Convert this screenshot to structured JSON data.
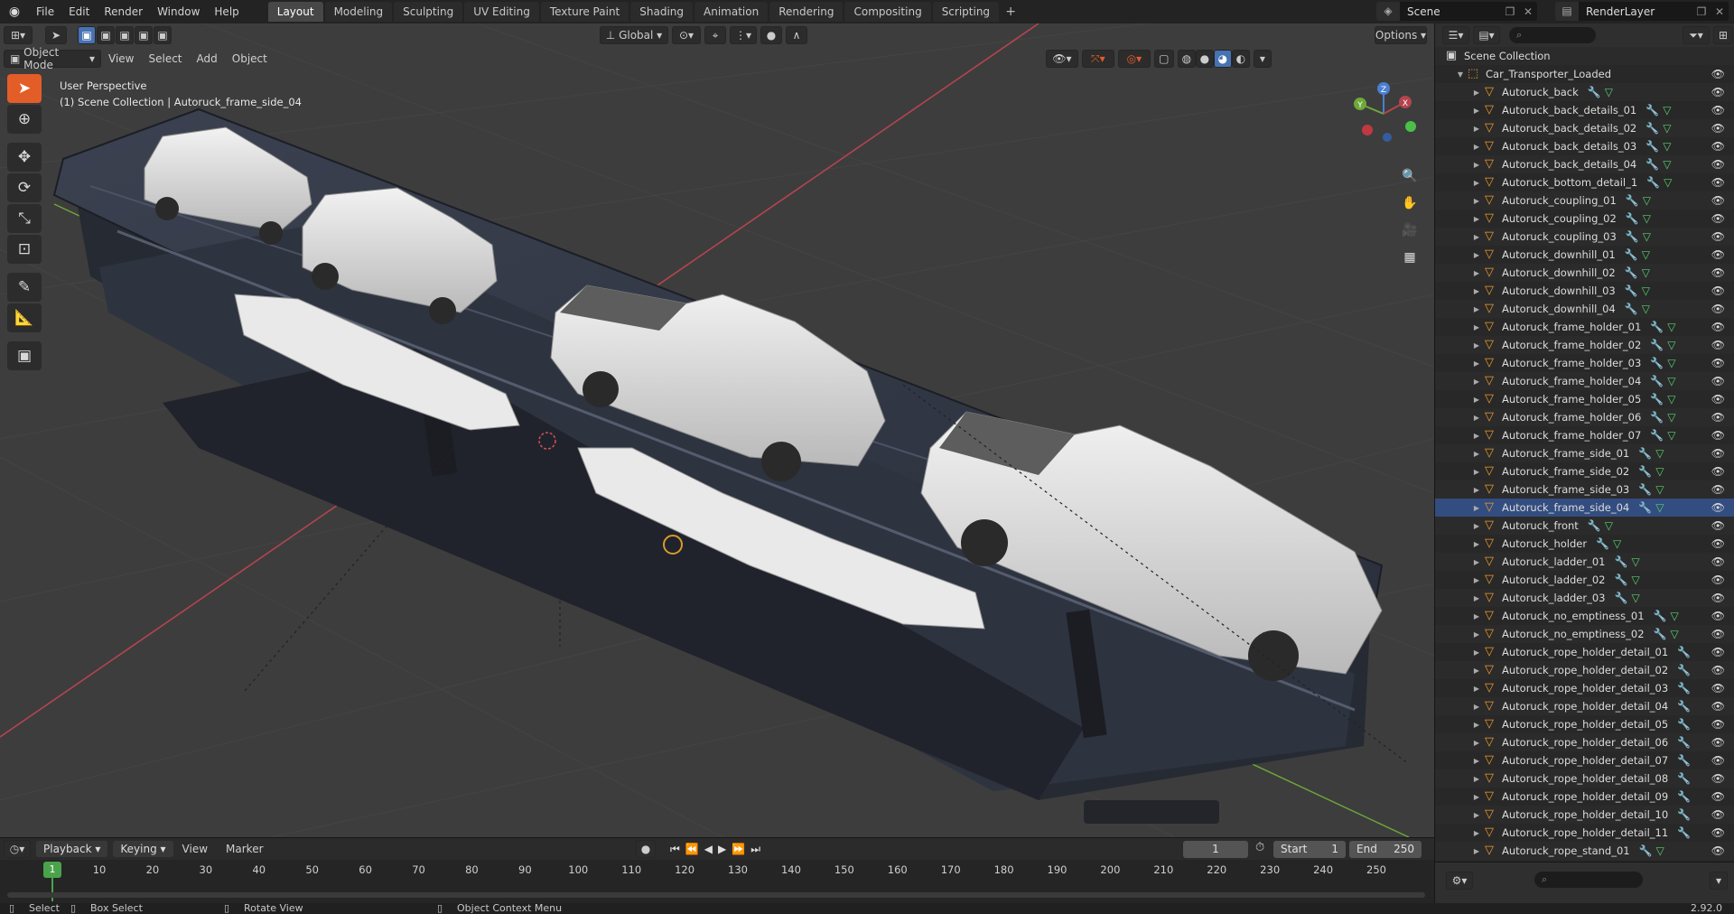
{
  "menubar": {
    "menus": [
      "File",
      "Edit",
      "Render",
      "Window",
      "Help"
    ],
    "workspaces": [
      "Layout",
      "Modeling",
      "Sculpting",
      "UV Editing",
      "Texture Paint",
      "Shading",
      "Animation",
      "Rendering",
      "Compositing",
      "Scripting"
    ],
    "active_workspace": "Layout",
    "add_tab": "+",
    "scene_name": "Scene",
    "view_layer": "RenderLayer"
  },
  "viewport": {
    "mode": "Object Mode",
    "menus": [
      "View",
      "Select",
      "Add",
      "Object"
    ],
    "transform_orientation": "Global",
    "options_label": "Options",
    "view_name": "User Perspective",
    "context_path": "(1) Scene Collection | Autoruck_frame_side_04",
    "gizmo_axes": {
      "z": "Z",
      "y": "Y",
      "x": "X"
    },
    "colors": {
      "x_axis": "#b5444e",
      "y_axis": "#6ea83a",
      "accent_active": "#e35d28",
      "selection": "#334d80"
    }
  },
  "outliner": {
    "root": "Scene Collection",
    "collection": "Car_Transporter_Loaded",
    "selected": "Autoruck_frame_side_04",
    "items": [
      {
        "name": "Autoruck_back",
        "mod": true
      },
      {
        "name": "Autoruck_back_details_01",
        "mod": true
      },
      {
        "name": "Autoruck_back_details_02",
        "mod": true
      },
      {
        "name": "Autoruck_back_details_03",
        "mod": true
      },
      {
        "name": "Autoruck_back_details_04",
        "mod": true
      },
      {
        "name": "Autoruck_bottom_detail_1",
        "mod": true
      },
      {
        "name": "Autoruck_coupling_01",
        "mod": true
      },
      {
        "name": "Autoruck_coupling_02",
        "mod": true
      },
      {
        "name": "Autoruck_coupling_03",
        "mod": true
      },
      {
        "name": "Autoruck_downhill_01",
        "mod": true
      },
      {
        "name": "Autoruck_downhill_02",
        "mod": true
      },
      {
        "name": "Autoruck_downhill_03",
        "mod": true
      },
      {
        "name": "Autoruck_downhill_04",
        "mod": true
      },
      {
        "name": "Autoruck_frame_holder_01",
        "mod": true
      },
      {
        "name": "Autoruck_frame_holder_02",
        "mod": true
      },
      {
        "name": "Autoruck_frame_holder_03",
        "mod": true
      },
      {
        "name": "Autoruck_frame_holder_04",
        "mod": true
      },
      {
        "name": "Autoruck_frame_holder_05",
        "mod": true
      },
      {
        "name": "Autoruck_frame_holder_06",
        "mod": true
      },
      {
        "name": "Autoruck_frame_holder_07",
        "mod": true
      },
      {
        "name": "Autoruck_frame_side_01",
        "mod": true
      },
      {
        "name": "Autoruck_frame_side_02",
        "mod": true
      },
      {
        "name": "Autoruck_frame_side_03",
        "mod": true
      },
      {
        "name": "Autoruck_frame_side_04",
        "mod": true
      },
      {
        "name": "Autoruck_front",
        "mod": true
      },
      {
        "name": "Autoruck_holder",
        "mod": true
      },
      {
        "name": "Autoruck_ladder_01",
        "mod": true
      },
      {
        "name": "Autoruck_ladder_02",
        "mod": true
      },
      {
        "name": "Autoruck_ladder_03",
        "mod": true
      },
      {
        "name": "Autoruck_no_emptiness_01",
        "mod": true
      },
      {
        "name": "Autoruck_no_emptiness_02",
        "mod": true
      },
      {
        "name": "Autoruck_rope_holder_detail_01",
        "mod": false
      },
      {
        "name": "Autoruck_rope_holder_detail_02",
        "mod": false
      },
      {
        "name": "Autoruck_rope_holder_detail_03",
        "mod": false
      },
      {
        "name": "Autoruck_rope_holder_detail_04",
        "mod": false
      },
      {
        "name": "Autoruck_rope_holder_detail_05",
        "mod": false
      },
      {
        "name": "Autoruck_rope_holder_detail_06",
        "mod": false
      },
      {
        "name": "Autoruck_rope_holder_detail_07",
        "mod": false
      },
      {
        "name": "Autoruck_rope_holder_detail_08",
        "mod": false
      },
      {
        "name": "Autoruck_rope_holder_detail_09",
        "mod": false
      },
      {
        "name": "Autoruck_rope_holder_detail_10",
        "mod": false
      },
      {
        "name": "Autoruck_rope_holder_detail_11",
        "mod": false
      },
      {
        "name": "Autoruck_rope_stand_01",
        "mod": true
      }
    ]
  },
  "timeline": {
    "menus": [
      "Playback",
      "Keying",
      "View",
      "Marker"
    ],
    "current_frame": "1",
    "start_label": "Start",
    "start": "1",
    "end_label": "End",
    "end": "250",
    "ticks": [
      "10",
      "20",
      "30",
      "40",
      "50",
      "60",
      "70",
      "80",
      "90",
      "100",
      "110",
      "120",
      "130",
      "140",
      "150",
      "160",
      "170",
      "180",
      "190",
      "200",
      "210",
      "220",
      "230",
      "240",
      "250"
    ],
    "cursor_label": "1"
  },
  "statusbar": {
    "select": "Select",
    "box_select": "Box Select",
    "rotate_view": "Rotate View",
    "context_menu": "Object Context Menu",
    "version": "2.92.0"
  }
}
